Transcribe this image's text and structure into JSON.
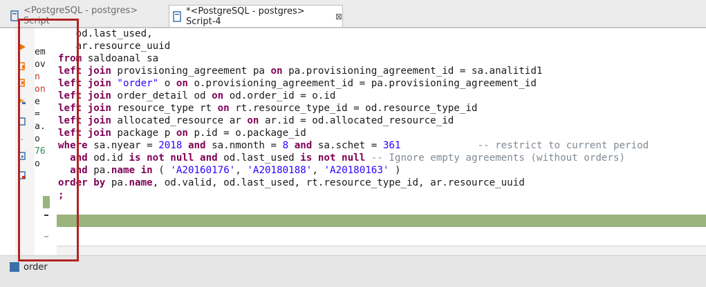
{
  "tabs": [
    {
      "label": "<PostgreSQL - postgres> Script",
      "active": false
    },
    {
      "label": "*<PostgreSQL - postgres> Script-4",
      "active": true,
      "close": "⊠"
    }
  ],
  "left_fragments": [
    "em",
    "ov",
    "n",
    "on",
    "e",
    "=",
    "a.",
    "o",
    "76",
    "o"
  ],
  "code_lines": [
    [
      {
        "t": "   od.last_used,"
      }
    ],
    [
      {
        "t": "   ar.resource_uuid"
      }
    ],
    [
      {
        "t": "from",
        "c": "kw"
      },
      {
        "t": " saldoanal sa"
      }
    ],
    [
      {
        "t": "left join",
        "c": "kw"
      },
      {
        "t": " provisioning_agreement pa "
      },
      {
        "t": "on",
        "c": "kw"
      },
      {
        "t": " pa.provisioning_agreement_id = sa.analitid1"
      }
    ],
    [
      {
        "t": "left join",
        "c": "kw"
      },
      {
        "t": " "
      },
      {
        "t": "\"order\"",
        "c": "str"
      },
      {
        "t": " o "
      },
      {
        "t": "on",
        "c": "kw"
      },
      {
        "t": " o.provisioning_agreement_id = pa.provisioning_agreement_id"
      }
    ],
    [
      {
        "t": "left join",
        "c": "kw"
      },
      {
        "t": " order_detail od "
      },
      {
        "t": "on",
        "c": "kw"
      },
      {
        "t": " od.order_id = o.id"
      }
    ],
    [
      {
        "t": "left join",
        "c": "kw"
      },
      {
        "t": " resource_type rt "
      },
      {
        "t": "on",
        "c": "kw"
      },
      {
        "t": " rt.resource_type_id = od.resource_type_id"
      }
    ],
    [
      {
        "t": "left join",
        "c": "kw"
      },
      {
        "t": " allocated_resource ar "
      },
      {
        "t": "on",
        "c": "kw"
      },
      {
        "t": " ar.id = od.allocated_resource_id"
      }
    ],
    [
      {
        "t": "left join",
        "c": "kw"
      },
      {
        "t": " package p "
      },
      {
        "t": "on",
        "c": "kw"
      },
      {
        "t": " p.id = o.package_id"
      }
    ],
    [
      {
        "t": "where",
        "c": "kw"
      },
      {
        "t": " sa.nyear = "
      },
      {
        "t": "2018",
        "c": "num"
      },
      {
        "t": " "
      },
      {
        "t": "and",
        "c": "kw"
      },
      {
        "t": " sa.nmonth = "
      },
      {
        "t": "8",
        "c": "num"
      },
      {
        "t": " "
      },
      {
        "t": "and",
        "c": "kw"
      },
      {
        "t": " sa.schet = "
      },
      {
        "t": "361",
        "c": "num"
      },
      {
        "t": "             "
      },
      {
        "t": "-- restrict to current period",
        "c": "cm"
      }
    ],
    [
      {
        "t": "  "
      },
      {
        "t": "and",
        "c": "kw"
      },
      {
        "t": " od.id "
      },
      {
        "t": "is not null",
        "c": "kw"
      },
      {
        "t": " "
      },
      {
        "t": "and",
        "c": "kw"
      },
      {
        "t": " od.last_used "
      },
      {
        "t": "is not null",
        "c": "kw"
      },
      {
        "t": " "
      },
      {
        "t": "-- Ignore empty agreements (without orders)",
        "c": "cm"
      }
    ],
    [
      {
        "t": "  "
      },
      {
        "t": "and",
        "c": "kw"
      },
      {
        "t": " pa."
      },
      {
        "t": "name",
        "c": "kw"
      },
      {
        "t": " "
      },
      {
        "t": "in",
        "c": "kw"
      },
      {
        "t": " ( "
      },
      {
        "t": "'A20160176'",
        "c": "str"
      },
      {
        "t": ", "
      },
      {
        "t": "'A20180188'",
        "c": "str"
      },
      {
        "t": ", "
      },
      {
        "t": "'A20180163'",
        "c": "str"
      },
      {
        "t": " )"
      }
    ],
    [
      {
        "t": "order by",
        "c": "kw"
      },
      {
        "t": " pa."
      },
      {
        "t": "name",
        "c": "kw"
      },
      {
        "t": ", od.valid, od.last_used, rt.resource_type_id, ar.resource_uuid"
      }
    ],
    [
      {
        "t": ";",
        "c": "kw"
      }
    ]
  ],
  "bottom_tab": {
    "label": "order"
  },
  "colors": {
    "annotation": "#b22222",
    "current_line": "#9bb37c",
    "keyword": "#7f0055"
  }
}
